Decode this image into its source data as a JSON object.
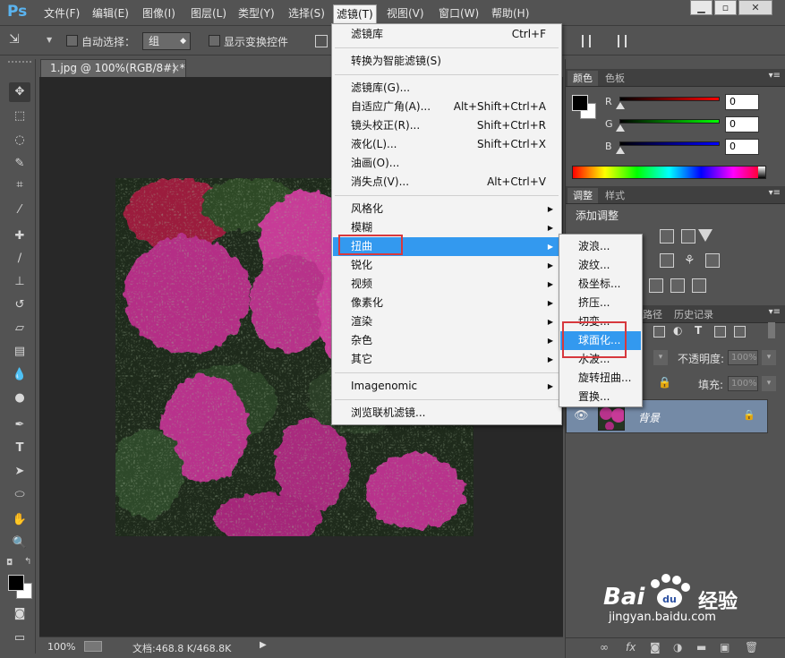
{
  "app": {
    "logo": "Ps"
  },
  "menubar": {
    "items": [
      "文件(F)",
      "编辑(E)",
      "图像(I)",
      "图层(L)",
      "类型(Y)",
      "选择(S)",
      "滤镜(T)",
      "视图(V)",
      "窗口(W)",
      "帮助(H)"
    ],
    "active": "滤镜(T)",
    "window_buttons": [
      "minimize",
      "restore",
      "close"
    ]
  },
  "options_bar": {
    "auto_select_label": "自动选择：",
    "auto_select_value": "组",
    "show_transform_label": "显示变换控件"
  },
  "document": {
    "tab_title": "1.jpg @ 100%(RGB/8#) *",
    "close_glyph": "×",
    "zoom": "100%",
    "doc_info": "文档:468.8 K/468.8K"
  },
  "filter_menu": {
    "items": [
      {
        "label": "滤镜库",
        "shortcut": "Ctrl+F"
      },
      {
        "label": "转换为智能滤镜(S)"
      },
      {
        "label": "滤镜库(G)..."
      },
      {
        "label": "自适应广角(A)...",
        "shortcut": "Alt+Shift+Ctrl+A"
      },
      {
        "label": "镜头校正(R)...",
        "shortcut": "Shift+Ctrl+R"
      },
      {
        "label": "液化(L)...",
        "shortcut": "Shift+Ctrl+X"
      },
      {
        "label": "油画(O)..."
      },
      {
        "label": "消失点(V)...",
        "shortcut": "Alt+Ctrl+V"
      },
      {
        "label": "风格化",
        "submenu": true
      },
      {
        "label": "模糊",
        "submenu": true
      },
      {
        "label": "扭曲",
        "submenu": true,
        "highlighted": true
      },
      {
        "label": "锐化",
        "submenu": true
      },
      {
        "label": "视频",
        "submenu": true
      },
      {
        "label": "像素化",
        "submenu": true
      },
      {
        "label": "渲染",
        "submenu": true
      },
      {
        "label": "杂色",
        "submenu": true
      },
      {
        "label": "其它",
        "submenu": true
      },
      {
        "label": "Imagenomic",
        "submenu": true
      },
      {
        "label": "浏览联机滤镜..."
      }
    ]
  },
  "distort_submenu": {
    "items": [
      "波浪...",
      "波纹...",
      "极坐标...",
      "挤压...",
      "切变...",
      "球面化...",
      "水波...",
      "旋转扭曲...",
      "置换..."
    ],
    "highlighted": "球面化..."
  },
  "color_panel": {
    "tabs": [
      "颜色",
      "色板"
    ],
    "channels": [
      {
        "label": "R",
        "value": "0",
        "color": "#ff0000"
      },
      {
        "label": "G",
        "value": "0",
        "color": "#00ff00"
      },
      {
        "label": "B",
        "value": "0",
        "color": "#0000ff"
      }
    ]
  },
  "adjust_panel": {
    "tabs": [
      "调整",
      "样式"
    ],
    "title": "添加调整"
  },
  "layers_panel": {
    "tabs": [
      "路径",
      "历史记录"
    ],
    "opacity_label": "不透明度:",
    "opacity_value": "100%",
    "fill_label": "填充:",
    "fill_value": "100%",
    "layer_name": "背景"
  },
  "watermark": {
    "text": "Bai",
    "text2": "经验",
    "url": "jingyan.baidu.com"
  }
}
